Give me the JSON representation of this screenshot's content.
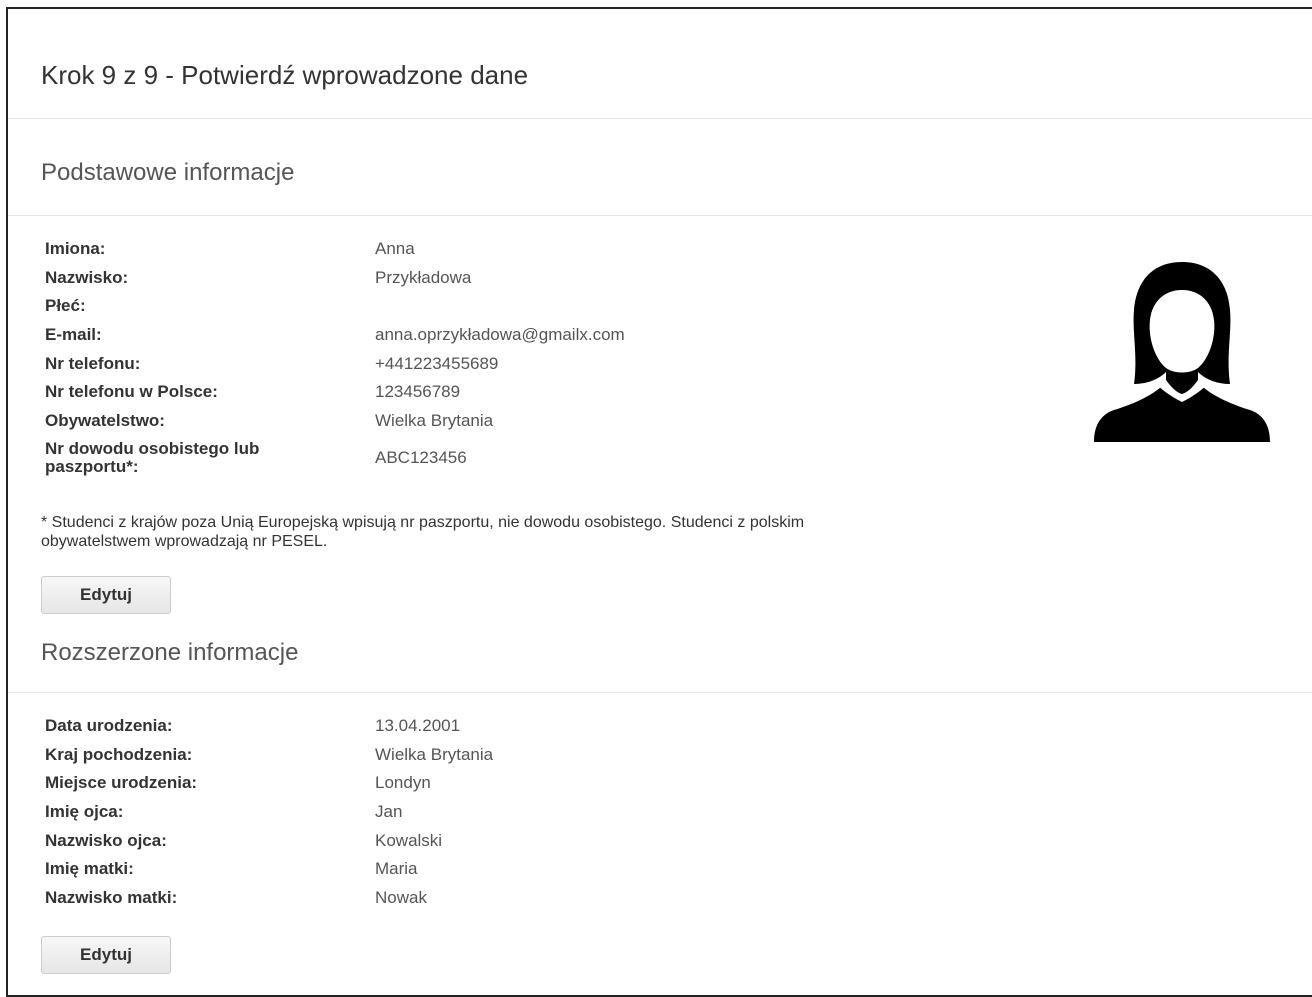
{
  "page": {
    "step_title": "Krok 9 z 9 - Potwierdź wprowadzone dane"
  },
  "basic": {
    "title": "Podstawowe informacje",
    "rows": [
      {
        "label": "Imiona:",
        "value": "Anna"
      },
      {
        "label": "Nazwisko:",
        "value": "Przykładowa"
      },
      {
        "label": "Płeć:",
        "value": ""
      },
      {
        "label": "E-mail:",
        "value": "anna.oprzykładowa@gmailx.com"
      },
      {
        "label": "Nr telefonu:",
        "value": "+441223455689"
      },
      {
        "label": "Nr telefonu w Polsce:",
        "value": "123456789"
      },
      {
        "label": "Obywatelstwo:",
        "value": "Wielka Brytania"
      },
      {
        "label": "Nr dowodu osobistego lub paszportu*:",
        "value": "ABC123456"
      }
    ],
    "note": "* Studenci z krajów poza Unią Europejską wpisują nr paszportu, nie dowodu osobistego. Studenci z polskim obywatelstwem wprowadzają nr PESEL.",
    "edit_label": "Edytuj",
    "avatar_icon": "female-user-silhouette-icon"
  },
  "extended": {
    "title": "Rozszerzone informacje",
    "rows": [
      {
        "label": "Data urodzenia:",
        "value": "13.04.2001"
      },
      {
        "label": "Kraj pochodzenia:",
        "value": "Wielka Brytania"
      },
      {
        "label": "Miejsce urodzenia:",
        "value": "Londyn"
      },
      {
        "label": "Imię ojca:",
        "value": "Jan"
      },
      {
        "label": "Nazwisko ojca:",
        "value": "Kowalski"
      },
      {
        "label": "Imię matki:",
        "value": "Maria"
      },
      {
        "label": "Nazwisko matki:",
        "value": "Nowak"
      }
    ],
    "edit_label": "Edytuj"
  }
}
